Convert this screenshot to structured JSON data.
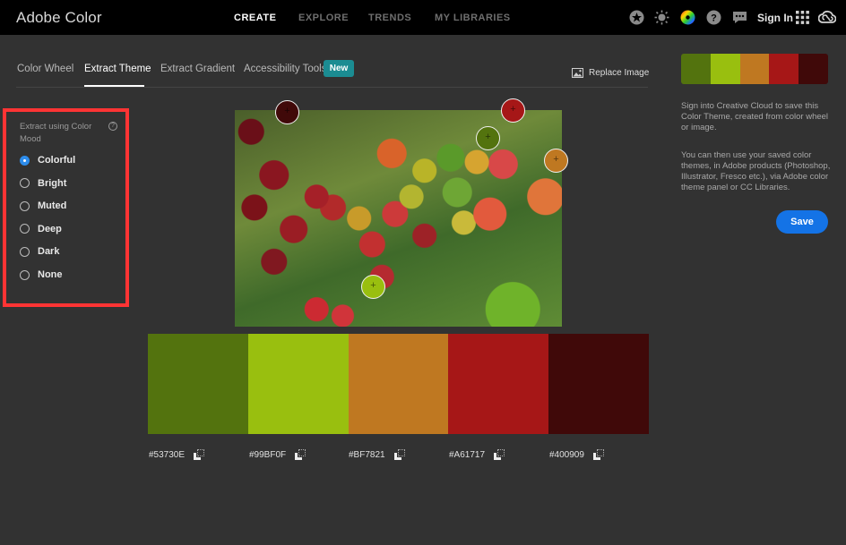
{
  "header": {
    "brand": "Adobe Color",
    "nav": [
      {
        "label": "CREATE",
        "active": true
      },
      {
        "label": "EXPLORE",
        "active": false
      },
      {
        "label": "TRENDS",
        "active": false
      },
      {
        "label": "MY LIBRARIES",
        "active": false
      }
    ],
    "icons": [
      "star-badge-icon",
      "brightness-icon",
      "color-wheel-icon",
      "help-icon",
      "chat-icon",
      "apps-grid-icon",
      "creative-cloud-icon"
    ],
    "sign_in": "Sign In"
  },
  "tabs": {
    "items": [
      {
        "label": "Color Wheel",
        "active": false
      },
      {
        "label": "Extract Theme",
        "active": true
      },
      {
        "label": "Extract Gradient",
        "active": false
      },
      {
        "label": "Accessibility Tools",
        "active": false
      }
    ],
    "new_badge": "New",
    "replace_image": "Replace Image"
  },
  "mood_panel": {
    "title": "Extract using Color Mood",
    "help": "?",
    "options": [
      {
        "label": "Colorful",
        "checked": true
      },
      {
        "label": "Bright",
        "checked": false
      },
      {
        "label": "Muted",
        "checked": false
      },
      {
        "label": "Deep",
        "checked": false
      },
      {
        "label": "Dark",
        "checked": false
      },
      {
        "label": "None",
        "checked": false
      }
    ]
  },
  "theme": {
    "swatches": [
      {
        "hex": "#53730E",
        "color": "#53730e"
      },
      {
        "hex": "#99BF0F",
        "color": "#99bf0f"
      },
      {
        "hex": "#BF7821",
        "color": "#bf7821"
      },
      {
        "hex": "#A61717",
        "color": "#a61717"
      },
      {
        "hex": "#400909",
        "color": "#400909"
      }
    ]
  },
  "right_panel": {
    "text1": "Sign into Creative Cloud to save this Color Theme, created from color wheel or image.",
    "text2": "You can then use your saved color themes, in Adobe products (Photoshop, Illustrator, Fresco etc.), via Adobe color theme panel or CC Libraries.",
    "save_label": "Save"
  },
  "colors": {
    "accent_blue": "#1473e6",
    "new_badge": "#1b8c92",
    "highlight_border": "#ff3434"
  }
}
